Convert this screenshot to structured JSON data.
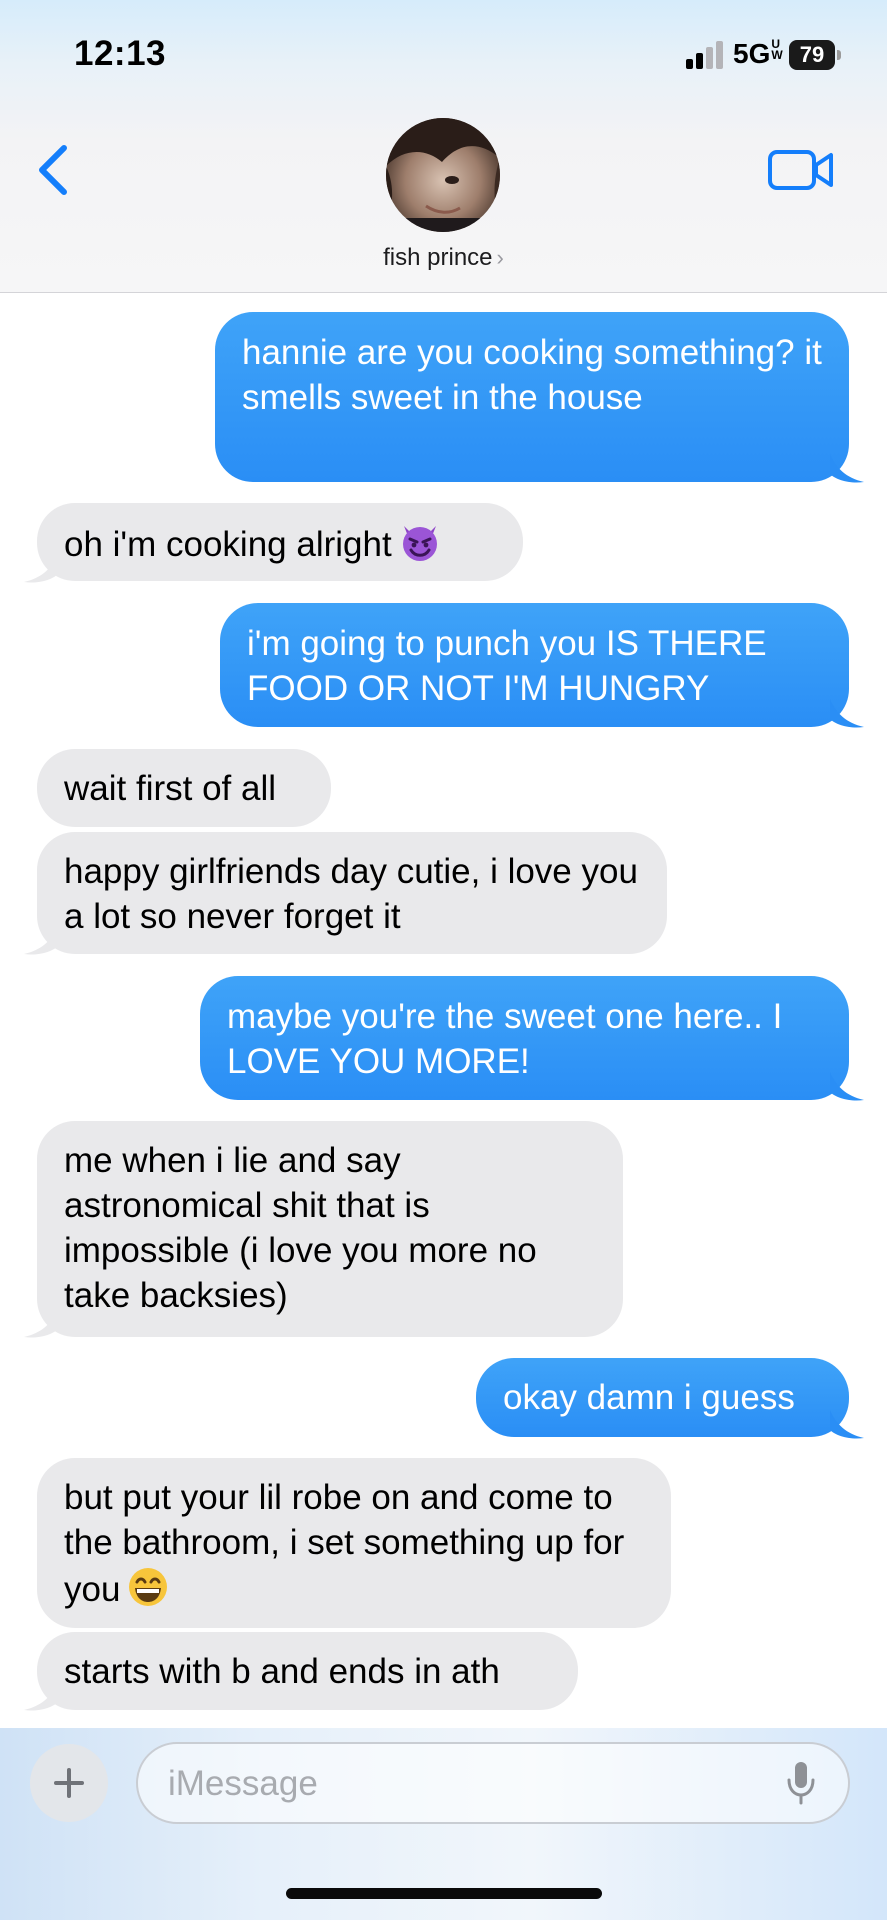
{
  "status_bar": {
    "time": "12:13",
    "network": "5G",
    "network_suffix": "UW",
    "battery": "79"
  },
  "header": {
    "contact_name": "fish prince",
    "chevron": "›",
    "back_icon": "chevron-left-icon",
    "call_icon": "video-camera-icon"
  },
  "messages": [
    {
      "from": "me",
      "text": "hannie are you cooking something? it smells sweet in the house"
    },
    {
      "from": "them",
      "text": "oh i'm cooking alright",
      "emoji": "smiling-imp-emoji"
    },
    {
      "from": "me",
      "text": "i'm going to punch you IS THERE FOOD OR NOT I'M HUNGRY"
    },
    {
      "from": "them",
      "text": "wait first of all"
    },
    {
      "from": "them",
      "text": "happy girlfriends day cutie, i love you a lot so never forget it"
    },
    {
      "from": "me",
      "text": "maybe you're the sweet one here.. I LOVE YOU MORE!"
    },
    {
      "from": "them",
      "text": "me when i lie and say astronomical shit that is impossible (i love you more no take backsies)"
    },
    {
      "from": "me",
      "text": "okay damn i guess"
    },
    {
      "from": "them",
      "text": "but put your lil robe on and come to the bathroom, i set something up for you",
      "emoji": "grinning-face-emoji"
    },
    {
      "from": "them",
      "text": "starts with b and ends in ath"
    }
  ],
  "compose": {
    "placeholder": "iMessage",
    "add_icon": "plus-icon",
    "mic_icon": "microphone-icon"
  },
  "colors": {
    "sent_bubble": "#2a8ef5",
    "received_bubble": "#e9e9eb",
    "accent": "#147efb"
  }
}
